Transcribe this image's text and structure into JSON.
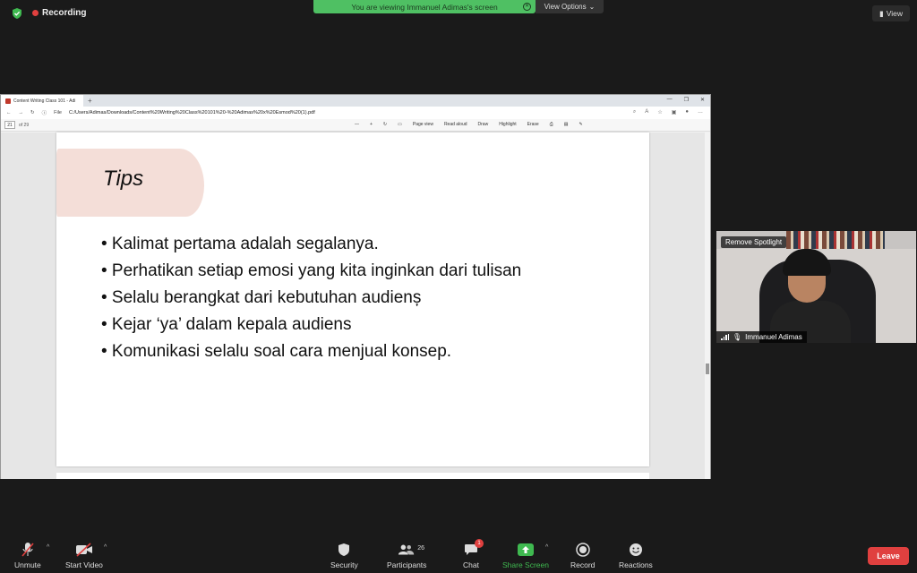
{
  "top": {
    "recording_label": "Recording",
    "viewing_banner": "You are viewing Immanuel Adimas's screen",
    "view_options_label": "View Options",
    "view_button_label": "View"
  },
  "browser": {
    "tab_title": "Content Writing Class 101 - Adi",
    "file_label": "File",
    "url": "C:/Users/Adimas/Downloads/Content%20Writing%20Class%20101%20-%20Adimas%20x%20Esmod%20(1).pdf",
    "page_number": "21",
    "page_total": "of 29",
    "tools": [
      "Page view",
      "Read aloud",
      "Draw",
      "Highlight",
      "Erase"
    ]
  },
  "slide": {
    "title": "Tips",
    "bullets": [
      "• Kalimat pertama adalah segalanya.",
      "• Perhatikan setiap emosi yang kita inginkan dari tulisan",
      "• Selalu berangkat dari kebutuhan audienș",
      "• Kejar ‘ya’ dalam kepala audiens",
      "• Komunikasi selalu soal cara menjual konsep."
    ]
  },
  "video": {
    "remove_spotlight": "Remove Spotlight",
    "participant_name": "Immanuel Adimas"
  },
  "toolbar": {
    "unmute": "Unmute",
    "start_video": "Start Video",
    "security": "Security",
    "participants": "Participants",
    "participants_count": "26",
    "chat": "Chat",
    "chat_badge": "1",
    "share_screen": "Share Screen",
    "record": "Record",
    "reactions": "Reactions",
    "leave": "Leave"
  },
  "colors": {
    "leave_red": "#e0403f",
    "banner_green": "#4fc063",
    "share_green": "#3fb950"
  }
}
